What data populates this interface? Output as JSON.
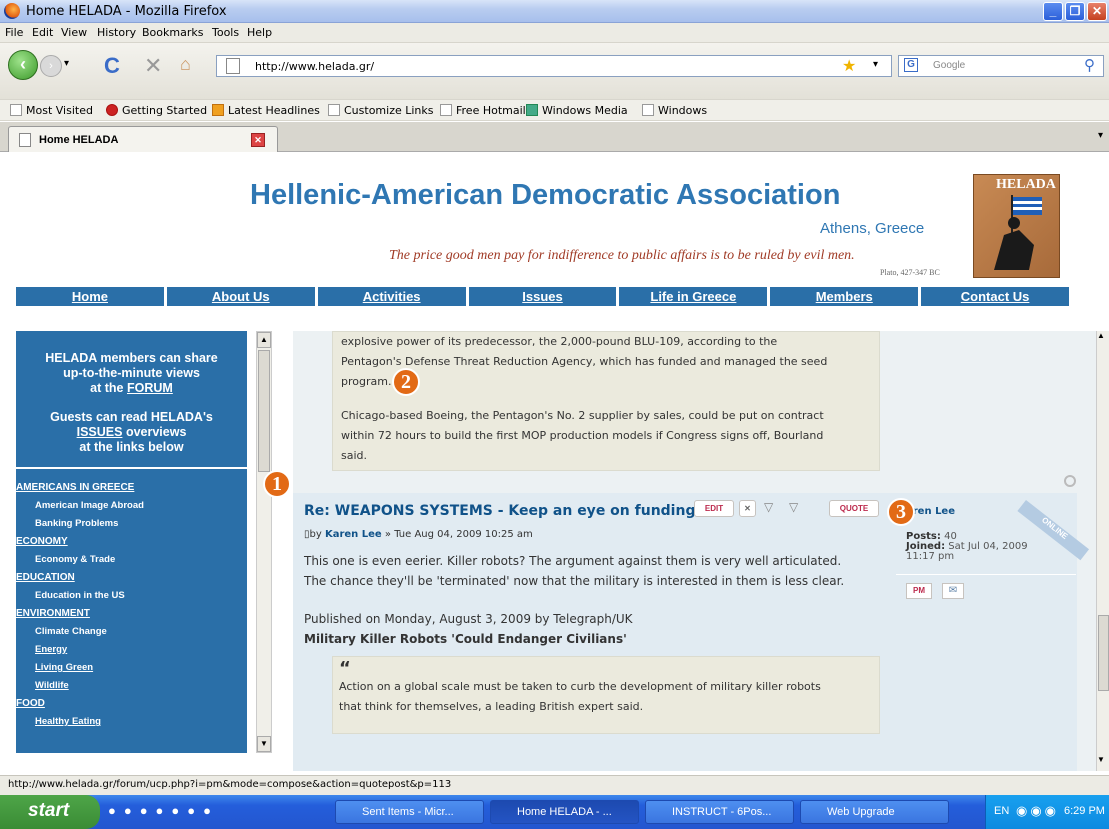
{
  "window": {
    "title": "Home HELADA - Mozilla Firefox"
  },
  "menu": [
    "File",
    "Edit",
    "View",
    "History",
    "Bookmarks",
    "Tools",
    "Help"
  ],
  "url": "http://www.helada.gr/",
  "search_placeholder": "Google",
  "bookmarks": [
    "Most Visited",
    "Getting Started",
    "Latest Headlines",
    "Customize Links",
    "Free Hotmail",
    "Windows Media",
    "Windows"
  ],
  "tab": {
    "label": "Home HELADA"
  },
  "header": {
    "title": "Hellenic-American Democratic Association",
    "subtitle": "Athens, Greece",
    "quote": "The price good men pay for indifference to public affairs is to be ruled by evil men.",
    "cite": "Plato, 427-347 BC",
    "logo_text": "HELADA"
  },
  "nav": [
    "Home",
    "About Us",
    "Activities",
    "Issues",
    "Life in Greece",
    "Members",
    "Contact Us"
  ],
  "sidebar": {
    "promo1": "HELADA members can share",
    "promo2": "up-to-the-minute views",
    "promo3": "at the",
    "promo3_link": "FORUM",
    "promo4": "Guests can read HELADA's",
    "promo5_link": "ISSUES",
    "promo5": "overviews",
    "promo6": "at the links below",
    "items": [
      {
        "t": "AMERICANS IN GREECE",
        "k": "cat"
      },
      {
        "t": "American Image Abroad",
        "k": "sub"
      },
      {
        "t": "Banking Problems",
        "k": "sub"
      },
      {
        "t": "ECONOMY",
        "k": "cat"
      },
      {
        "t": "Economy & Trade",
        "k": "sub"
      },
      {
        "t": "EDUCATION",
        "k": "cat"
      },
      {
        "t": "Education in the US",
        "k": "sub"
      },
      {
        "t": "ENVIRONMENT",
        "k": "cat"
      },
      {
        "t": "Climate Change",
        "k": "sub"
      },
      {
        "t": "Energy",
        "k": "subu"
      },
      {
        "t": "Living Green",
        "k": "subu"
      },
      {
        "t": "Wildlife",
        "k": "subu"
      },
      {
        "t": "FOOD",
        "k": "cat"
      },
      {
        "t": "Healthy Eating",
        "k": "subu"
      }
    ]
  },
  "quote1": {
    "l1": "explosive power of its predecessor, the 2,000-pound BLU-109, according to the",
    "l2": "Pentagon's Defense Threat Reduction Agency, which has funded and managed the seed",
    "l3": "program.",
    "l4": "Chicago-based Boeing, the Pentagon's No. 2 supplier by sales, could be put on contract",
    "l5": "within 72 hours to build the first MOP production models if Congress signs off, Bourland",
    "l6": "said."
  },
  "post": {
    "title": "Re: WEAPONS SYSTEMS - Keep an eye on funding",
    "edit": "EDIT",
    "quote_btn": "QUOTE",
    "meta_by": "by",
    "author": "Karen Lee",
    "meta_date": "» Tue Aug 04, 2009 10:25 am",
    "body1": "This one is even eerier. Killer robots? The argument against them is very well articulated.",
    "body2": "The chance they'll be 'terminated' now that the military is interested in them is less clear.",
    "published": "Published on Monday, August 3, 2009 by Telegraph/UK",
    "article_title": "Military Killer Robots 'Could Endanger Civilians'",
    "quote_mark": "“",
    "quote_l1": "Action on a global scale must be taken to curb the development of military killer robots",
    "quote_l2": "that think for themselves, a leading British expert said."
  },
  "profile": {
    "name": "aren Lee",
    "posts_label": "Posts:",
    "posts": "40",
    "joined_label": "Joined:",
    "joined": "Sat Jul 04, 2009",
    "joined_time": "11:17 pm",
    "online": "ONLINE",
    "pm": "PM"
  },
  "badges": [
    "1",
    "2",
    "3"
  ],
  "status": "http://www.helada.gr/forum/ucp.php?i=pm&mode=compose&action=quotepost&p=113",
  "taskbar": {
    "start": "start",
    "tasks": [
      "Sent Items - Micr...",
      "Home HELADA - ...",
      "INSTRUCT - 6Pos...",
      "Web Upgrade"
    ],
    "lang": "EN",
    "clock": "6:29 PM"
  }
}
